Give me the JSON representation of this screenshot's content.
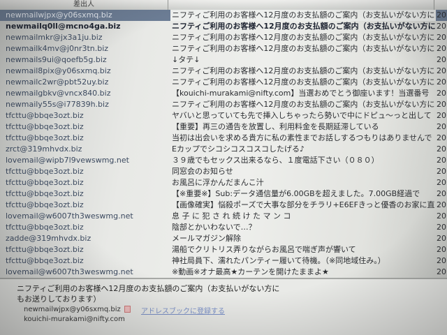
{
  "header": {
    "sender_label": "差出人"
  },
  "messages": [
    {
      "sender": "newmailwjpx@y06sxmq.biz",
      "subject": "ニフティご利用のお客様へ12月度のお支払額のご案内（お支払いがない方に",
      "date": "20",
      "selected": true,
      "unread": false
    },
    {
      "sender": "newmailq0ll@mcno4ga.biz",
      "subject": "ニフティご利用のお客様へ12月度のお支払額のご案内（お支払いがない方に",
      "date": "20",
      "selected": false,
      "unread": true
    },
    {
      "sender": "newmailmkr@jx3a1ju.biz",
      "subject": "ニフティご利用のお客様へ12月度のお支払額のご案内（お支払いがない方に",
      "date": "20",
      "selected": false,
      "unread": false
    },
    {
      "sender": "newmailk4mv@j0nr3tn.biz",
      "subject": "ニフティご利用のお客様へ12月度のお支払額のご案内（お支払いがない方に",
      "date": "20",
      "selected": false,
      "unread": false
    },
    {
      "sender": "newmails9ui@qoefb5g.biz",
      "subject": "↓タテ↓",
      "date": "20",
      "selected": false,
      "unread": false
    },
    {
      "sender": "newmail8pix@y06sxmq.biz",
      "subject": "ニフティご利用のお客様へ12月度のお支払額のご案内（お支払いがない方に",
      "date": "20",
      "selected": false,
      "unread": false
    },
    {
      "sender": "newmailc2wr@pbt52uy.biz",
      "subject": "ニフティご利用のお客様へ12月度のお支払額のご案内（お支払いがない方に",
      "date": "20",
      "selected": false,
      "unread": false
    },
    {
      "sender": "newmailgbkv@vncx840.biz",
      "subject": "【kouichi-murakami@nifty.com】当選おめでとう御座います！当選番号",
      "date": "20",
      "selected": false,
      "unread": false
    },
    {
      "sender": "newmaily55s@i77839h.biz",
      "subject": "ニフティご利用のお客様へ12月度のお支払額のご案内（お支払いがない方に",
      "date": "20",
      "selected": false,
      "unread": false
    },
    {
      "sender": "tfcttu@bbqe3ozt.biz",
      "subject": "ヤバいと思っていても先で挿入しちゃったら勢いで中にドピュ〜っと出して",
      "date": "20",
      "selected": false,
      "unread": false
    },
    {
      "sender": "tfcttu@bbqe3ozt.biz",
      "subject": "【重要】再三の通告を放置し、利用料金を長期延滞している",
      "date": "20",
      "selected": false,
      "unread": false
    },
    {
      "sender": "tfcttu@bbqe3ozt.biz",
      "subject": "当初は出会いを求める貴方に私の素性までお話しするつもりはありませんで",
      "date": "20",
      "selected": false,
      "unread": false
    },
    {
      "sender": "zrct@319mhvdx.biz",
      "subject": "Eカップでシコシコスコスコしたげる♪",
      "date": "20",
      "selected": false,
      "unread": false
    },
    {
      "sender": "lovemail@wipb7l9vewswmg.net",
      "subject": "３９歳でもセックス出来るなら、１度電話下さい（０８０）",
      "date": "20",
      "selected": false,
      "unread": false
    },
    {
      "sender": "tfcttu@bbqe3ozt.biz",
      "subject": "同窓会のお知らせ",
      "date": "20",
      "selected": false,
      "unread": false
    },
    {
      "sender": "tfcttu@bbqe3ozt.biz",
      "subject": "お風呂に浮かんだまんこ汁",
      "date": "20",
      "selected": false,
      "unread": false
    },
    {
      "sender": "tfcttu@bbqe3ozt.biz",
      "subject": "【※重要※】Sub:データ通信量が6.00GBを超えました。7.00GB経過で",
      "date": "20",
      "selected": false,
      "unread": false
    },
    {
      "sender": "tfcttu@bbqe3ozt.biz",
      "subject": "【画像確実】悩殺ポーズで大事な部分をチラリ+E6EFきっと優香のお家に直",
      "date": "20",
      "selected": false,
      "unread": false
    },
    {
      "sender": "lovemail@w6007th3weswmg.net",
      "subject": "息 子 に 犯 さ れ 続 け た マ ン コ",
      "date": "20",
      "selected": false,
      "unread": false
    },
    {
      "sender": "tfcttu@bbqe3ozt.biz",
      "subject": "陰部とかいわないで…？",
      "date": "20",
      "selected": false,
      "unread": false
    },
    {
      "sender": "zadde@319mhvdx.biz",
      "subject": "メールマガジン解除",
      "date": "20",
      "selected": false,
      "unread": false
    },
    {
      "sender": "tfcttu@bbqe3ozt.biz",
      "subject": "湯船でクリトリス弄りながらお風呂で喘ぎ声が響いて",
      "date": "20",
      "selected": false,
      "unread": false
    },
    {
      "sender": "tfcttu@bbqe3ozt.biz",
      "subject": "神社局員下、濡れたパンティー履いて待機。（※同地域住み。）",
      "date": "20",
      "selected": false,
      "unread": false
    },
    {
      "sender": "lovemail@w6007th3weswmg.net",
      "subject": "※動画※オナ最高★カーテンを開けたままよ★",
      "date": "20",
      "selected": false,
      "unread": false
    }
  ],
  "preview": {
    "subject": "ニフティご利用のお客様へ12月度のお支払額のご案内（お支払いがない方にもお送りしております）",
    "from": "newmailwjpx@y06sxmq.biz",
    "addressbook_label": "アドレスブックに登録する",
    "to": "kouichi-murakami@nifty.com"
  }
}
